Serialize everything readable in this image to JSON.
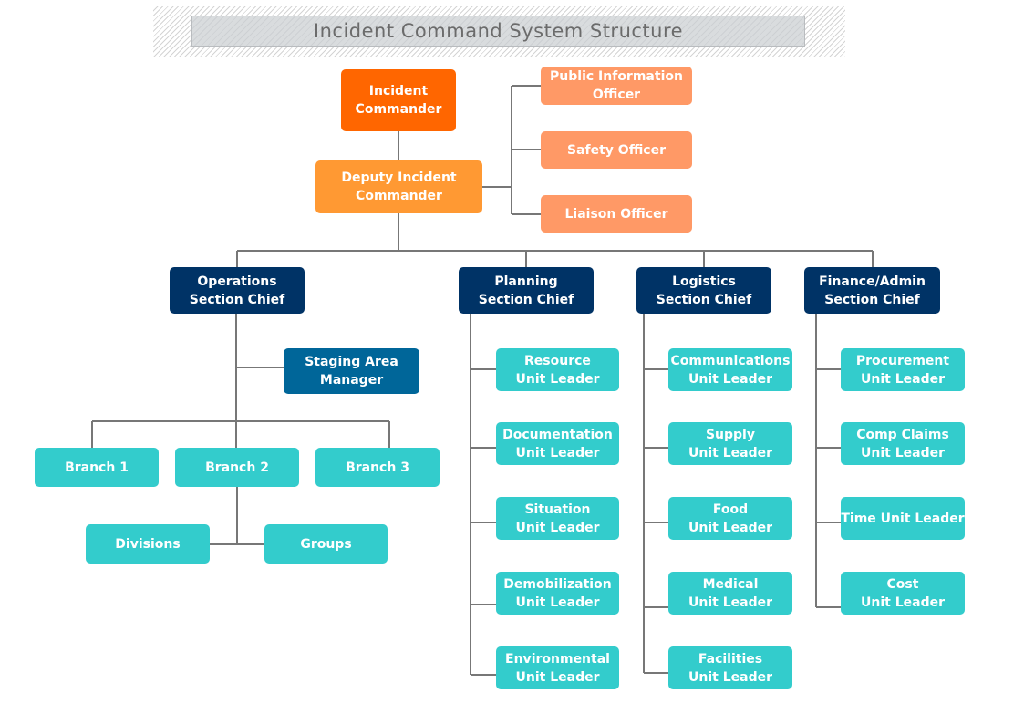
{
  "title": "Incident Command System Structure",
  "colors": {
    "command": "#ff6600",
    "deputy": "#ff9933",
    "command_staff": "#ff9966",
    "section_chief": "#003366",
    "staging": "#006699",
    "unit": "#33cccc",
    "connector": "#777777"
  },
  "command": {
    "incident_commander": "Incident\nCommander",
    "deputy": "Deputy Incident\nCommander",
    "staff": [
      "Public Information\nOfficer",
      "Safety Officer",
      "Liaison Officer"
    ]
  },
  "sections": [
    {
      "chief": "Operations\nSection Chief",
      "staging": "Staging Area\nManager",
      "branches": [
        "Branch 1",
        "Branch 2",
        "Branch 3"
      ],
      "sub_units": [
        "Divisions",
        "Groups"
      ]
    },
    {
      "chief": "Planning\nSection Chief",
      "units": [
        "Resource\nUnit Leader",
        "Documentation\nUnit Leader",
        "Situation\nUnit Leader",
        "Demobilization\nUnit Leader",
        "Environmental\nUnit Leader"
      ]
    },
    {
      "chief": "Logistics\nSection Chief",
      "units": [
        "Communications\nUnit Leader",
        "Supply\nUnit Leader",
        "Food\nUnit Leader",
        "Medical\nUnit Leader",
        "Facilities\nUnit Leader"
      ]
    },
    {
      "chief": "Finance/Admin\nSection Chief",
      "units": [
        "Procurement\nUnit Leader",
        "Comp Claims\nUnit Leader",
        "Time Unit Leader",
        "Cost\nUnit Leader"
      ]
    }
  ]
}
